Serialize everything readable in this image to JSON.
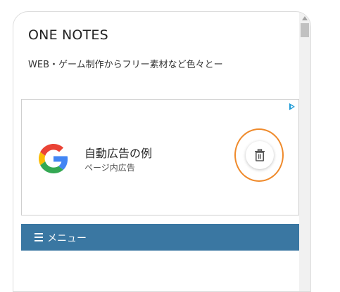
{
  "site": {
    "title": "ONE NOTES",
    "description": "WEB・ゲーム制作からフリー素材など色々とー"
  },
  "ad": {
    "title": "自動広告の例",
    "subtitle": "ページ内広告",
    "logo_icon": "google-g-icon",
    "choices_icon": "adchoices-icon",
    "delete_icon": "trash-icon",
    "highlight_color": "#ef8a2b"
  },
  "menu": {
    "icon": "hamburger-icon",
    "label": "メニュー",
    "color": "#3a77a2"
  }
}
